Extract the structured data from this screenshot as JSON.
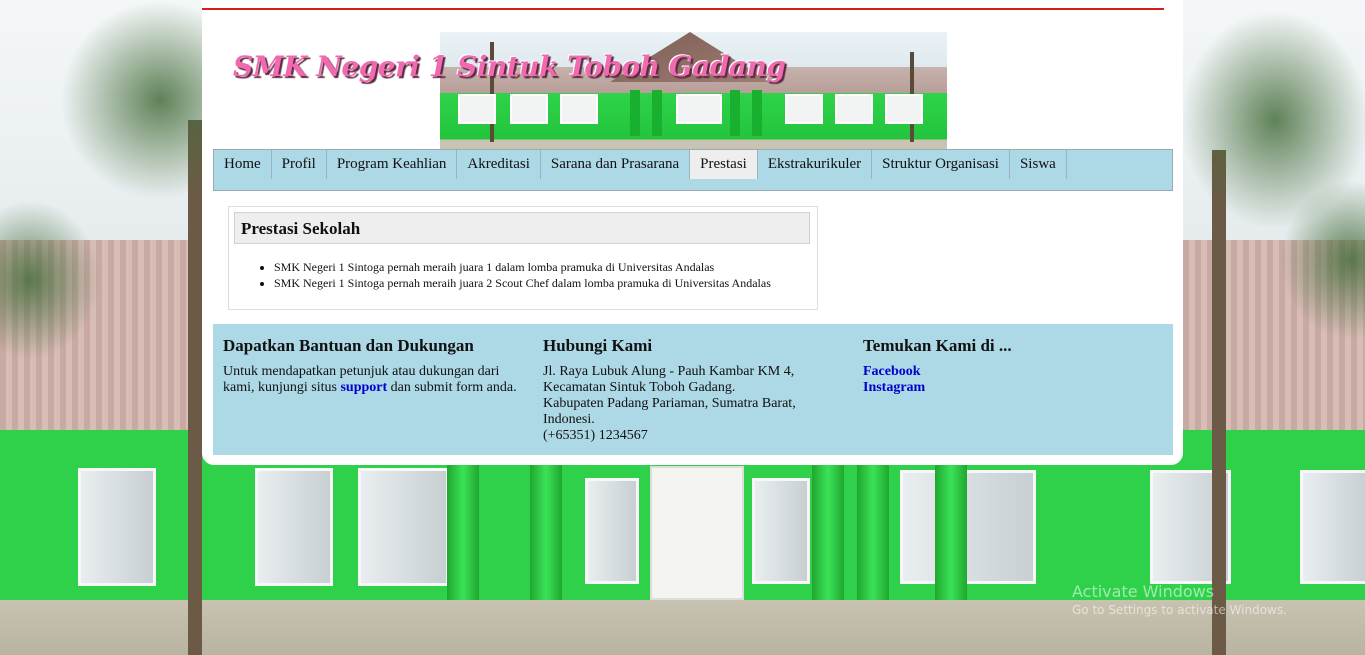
{
  "header": {
    "site_title": "SMK Negeri 1 Sintuk Toboh Gadang"
  },
  "nav": {
    "items": [
      {
        "label": "Home"
      },
      {
        "label": "Profil"
      },
      {
        "label": "Program Keahlian"
      },
      {
        "label": "Akreditasi"
      },
      {
        "label": "Sarana dan Prasarana"
      },
      {
        "label": "Prestasi"
      },
      {
        "label": "Ekstrakurikuler"
      },
      {
        "label": "Struktur Organisasi"
      },
      {
        "label": "Siswa"
      }
    ],
    "active": "Prestasi"
  },
  "content": {
    "heading": "Prestasi Sekolah",
    "items": [
      "SMK Negeri 1 Sintoga pernah meraih juara 1 dalam lomba pramuka di Universitas Andalas",
      "SMK Negeri 1 Sintoga pernah meraih juara 2 Scout Chef dalam lomba pramuka di Universitas Andalas"
    ]
  },
  "footer": {
    "support": {
      "heading": "Dapatkan Bantuan dan Dukungan",
      "text_before": "Untuk mendapatkan petunjuk atau dukungan dari kami, kunjungi situs ",
      "link": "support",
      "text_after": " dan submit form anda."
    },
    "contact": {
      "heading": "Hubungi Kami",
      "line1": "Jl. Raya Lubuk Alung - Pauh Kambar KM 4,",
      "line2": "Kecamatan Sintuk Toboh Gadang.",
      "line3": "Kabupaten Padang Pariaman, Sumatra Barat,",
      "line4": "Indonesi.",
      "phone": "(+65351) 1234567"
    },
    "social": {
      "heading": "Temukan Kami di ...",
      "facebook": "Facebook",
      "instagram": "Instagram"
    }
  },
  "watermark": {
    "line1": "Activate Windows",
    "line2": "Go to Settings to activate Windows."
  },
  "colors": {
    "accent_line": "#d61c1c",
    "nav_bg": "#add8e6",
    "footer_bg": "#add8e6",
    "title_pink": "#f06ab0",
    "link": "#0000cc"
  }
}
